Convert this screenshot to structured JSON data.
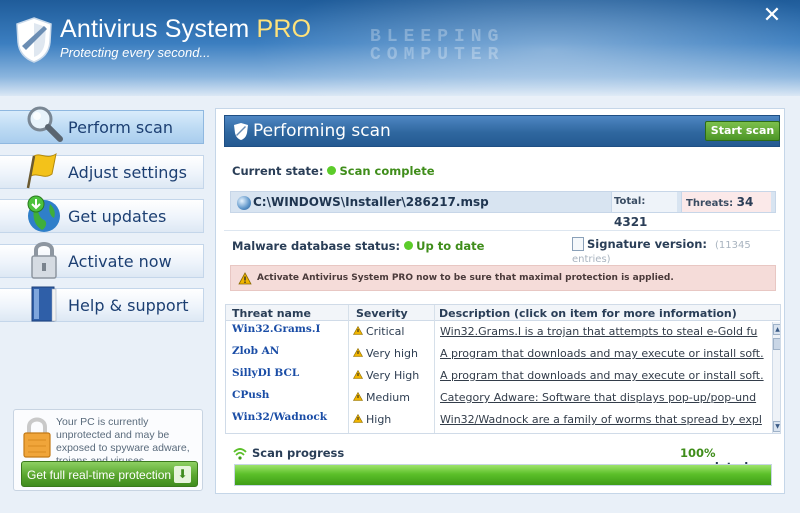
{
  "window": {
    "title": "Antivirus System",
    "title_suffix": "PRO",
    "subtitle": "Protecting every second...",
    "watermark_line1": "BLEEPING",
    "watermark_line2": "COMPUTER",
    "close_glyph": "✕"
  },
  "sidebar": {
    "items": [
      {
        "label": "Perform scan",
        "icon": "magnifier-icon",
        "active": true
      },
      {
        "label": "Adjust settings",
        "icon": "flag-icon"
      },
      {
        "label": "Get updates",
        "icon": "globe-update-icon"
      },
      {
        "label": "Activate now",
        "icon": "padlock-icon"
      },
      {
        "label": "Help & support",
        "icon": "book-icon"
      }
    ],
    "promo": {
      "text": "Your PC is currently unprotected and may be exposed to spyware adware, trojans and viruses",
      "button_label": "Get full real-time protection",
      "button_icon_glyph": "⬇"
    }
  },
  "panel": {
    "title": "Performing scan",
    "start_button": "Start scan",
    "current_state_label": "Current state:",
    "current_state_value": "Scan complete",
    "scan_path": "C:\\WINDOWS\\Installer\\286217.msp",
    "total_label": "Total:",
    "total_value": "4321",
    "threats_label": "Threats:",
    "threats_value": "34",
    "db_status_label": "Malware database status:",
    "db_status_value": "Up to date",
    "signature_label": "Signature version:",
    "signature_count": "(11345 entries)",
    "warning_text": "Activate Antivirus System PRO now to be sure that maximal protection is applied.",
    "table": {
      "headers": [
        "Threat name",
        "Severity",
        "Description (click on item for more information)"
      ],
      "rows": [
        {
          "name": "Win32.Grams.I",
          "severity": "Critical",
          "description": "Win32.Grams.I is a trojan that attempts to steal e-Gold fu"
        },
        {
          "name": "Zlob AN",
          "severity": "Very high",
          "description": "A program that downloads and may execute or install soft."
        },
        {
          "name": "SillyDl BCL",
          "severity": "Very High",
          "description": "A program that downloads and may execute or install soft."
        },
        {
          "name": "CPush",
          "severity": "Medium",
          "description": "Category Adware: Software that displays pop-up/pop-und"
        },
        {
          "name": "Win32/Wadnock",
          "severity": "High",
          "description": "Win32/Wadnock are a family of worms that spread by expl"
        }
      ]
    },
    "progress_label": "Scan progress",
    "progress_percent": "100%",
    "progress_suffix": "completed",
    "progress_fraction": 1.0
  },
  "colors": {
    "accent": "#2f679f",
    "success": "#3f8d1a",
    "warning_bg": "#f5dcd9",
    "progress": "#5cc02a"
  }
}
